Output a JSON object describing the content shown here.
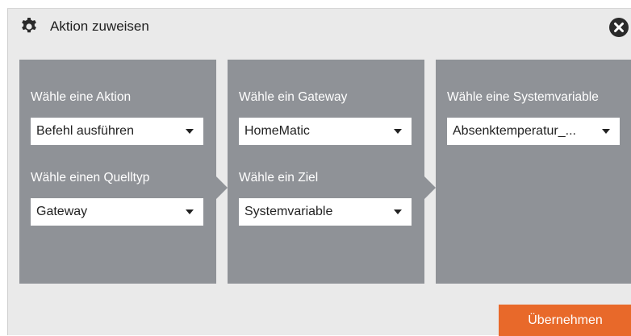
{
  "dialog": {
    "title": "Aktion zuweisen",
    "title_icon": "gear-icon",
    "close_icon": "close-icon",
    "apply_label": "Übernehmen",
    "accent_color": "#e8692a",
    "panel_color": "#8f9297"
  },
  "panels": [
    {
      "fields": [
        {
          "label": "Wähle eine Aktion",
          "value": "Befehl ausführen"
        },
        {
          "label": "Wähle einen Quelltyp",
          "value": "Gateway"
        }
      ]
    },
    {
      "fields": [
        {
          "label": "Wähle ein Gateway",
          "value": "HomeMatic"
        },
        {
          "label": "Wähle ein Ziel",
          "value": "Systemvariable"
        }
      ]
    },
    {
      "fields": [
        {
          "label": "Wähle eine Systemvariable",
          "value": "Absenktemperatur_..."
        }
      ]
    }
  ]
}
